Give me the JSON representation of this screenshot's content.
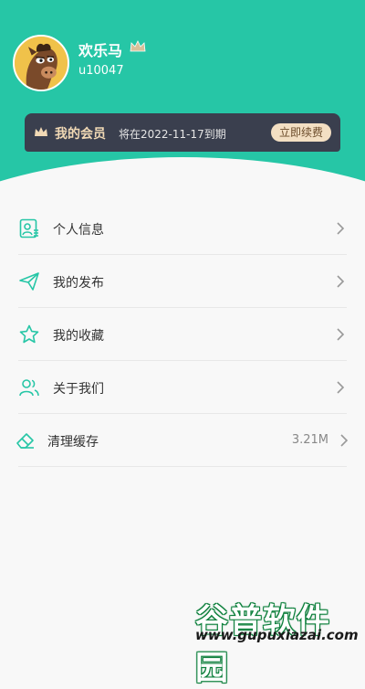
{
  "profile": {
    "name": "欢乐马",
    "user_id": "u10047"
  },
  "vip": {
    "title": "我的会员",
    "expire_text": "将在2022-11-17到期",
    "renew_label": "立即续费"
  },
  "menu": {
    "items": [
      {
        "label": "个人信息",
        "icon": "id-card-icon"
      },
      {
        "label": "我的发布",
        "icon": "send-icon"
      },
      {
        "label": "我的收藏",
        "icon": "star-icon"
      },
      {
        "label": "关于我们",
        "icon": "users-icon"
      },
      {
        "label": "清理缓存",
        "icon": "eraser-icon",
        "value": "3.21M"
      }
    ]
  },
  "watermark": {
    "brand": "谷普软件园",
    "url": "www.gupuxiazai.com"
  },
  "colors": {
    "accent": "#26c6a6",
    "vip_card": "#3a3f4e",
    "vip_gold": "#f1d9b5"
  }
}
